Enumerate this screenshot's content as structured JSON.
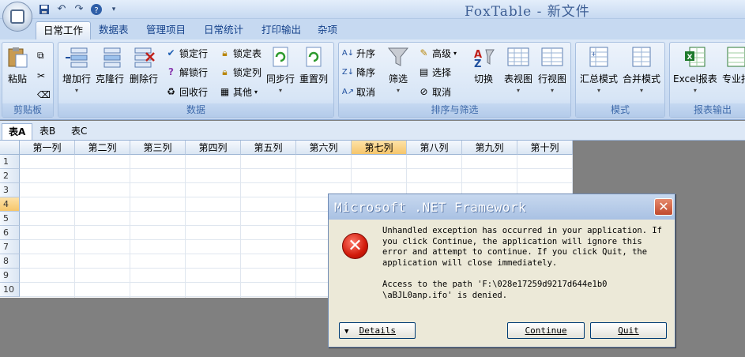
{
  "window": {
    "title": "FoxTable - 新文件"
  },
  "qat": {
    "icons": [
      "save-icon",
      "undo-icon",
      "redo-icon",
      "help-icon"
    ]
  },
  "tabs": [
    "日常工作",
    "数据表",
    "管理项目",
    "日常统计",
    "打印输出",
    "杂项"
  ],
  "ribbon": {
    "clipboard": {
      "label": "剪贴板",
      "paste": "粘贴"
    },
    "data": {
      "label": "数据",
      "add_row": "增加行",
      "clone_row": "克隆行",
      "delete_row": "删除行",
      "lock_row": "锁定行",
      "unlock_row": "解锁行",
      "recycle_row": "回收行",
      "lock_table": "锁定表",
      "lock_col": "锁定列",
      "other": "其他",
      "sync_row": "同步行",
      "redo_row": "重置列"
    },
    "sort_filter": {
      "label": "排序与筛选",
      "asc": "升序",
      "desc": "降序",
      "cancel1": "取消",
      "filter": "筛选",
      "advanced": "高级",
      "select": "选择",
      "cancel2": "取消",
      "switch": "切换",
      "table_view": "表视图",
      "row_view": "行视图"
    },
    "mode": {
      "label": "模式",
      "summary": "汇总模式",
      "merge": "合并模式"
    },
    "report": {
      "label": "报表输出",
      "excel": "Excel报表",
      "pro": "专业报"
    }
  },
  "sheets": [
    "表A",
    "表B",
    "表C"
  ],
  "grid": {
    "columns": [
      "第一列",
      "第二列",
      "第三列",
      "第四列",
      "第五列",
      "第六列",
      "第七列",
      "第八列",
      "第九列",
      "第十列"
    ],
    "rows": [
      "1",
      "2",
      "3",
      "4",
      "5",
      "6",
      "7",
      "8",
      "9",
      "10"
    ],
    "selected_column": "第七列",
    "selected_row": "4"
  },
  "dialog": {
    "title": "Microsoft .NET Framework",
    "close": "✕",
    "line1": "Unhandled exception has occurred in your application. If",
    "line2": "you click Continue, the application will ignore this",
    "line3": "error and attempt to continue. If you click Quit, the",
    "line4": "application will close immediately.",
    "line5": "Access to the path 'F:\\028e17259d9217d644e1b0",
    "line6": "\\aBJL0anp.ifo' is denied.",
    "details": "Details",
    "continue": "Continue",
    "quit": "Quit"
  }
}
